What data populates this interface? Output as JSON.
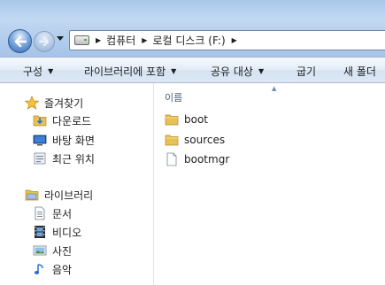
{
  "address": {
    "crumbs": [
      "컴퓨터",
      "로컬 디스크 (F:)"
    ]
  },
  "toolbar": {
    "organize": "구성",
    "include_in_library": "라이브러리에 포함",
    "share_with": "공유 대상",
    "burn": "굽기",
    "new_folder": "새 폴더"
  },
  "nav": {
    "favorites": {
      "label": "즐겨찾기",
      "items": [
        "다운로드",
        "바탕 화면",
        "최근 위치"
      ]
    },
    "libraries": {
      "label": "라이브러리",
      "items": [
        "문서",
        "비디오",
        "사진",
        "음악"
      ]
    }
  },
  "content": {
    "column_name": "이름",
    "files": [
      {
        "name": "boot",
        "icon": "folder-icon"
      },
      {
        "name": "sources",
        "icon": "folder-icon"
      },
      {
        "name": "bootmgr",
        "icon": "file-icon"
      }
    ]
  },
  "colors": {
    "glass": "#b6cfee",
    "toolbar": "#dbe7f5",
    "folder": "#e8c156"
  }
}
